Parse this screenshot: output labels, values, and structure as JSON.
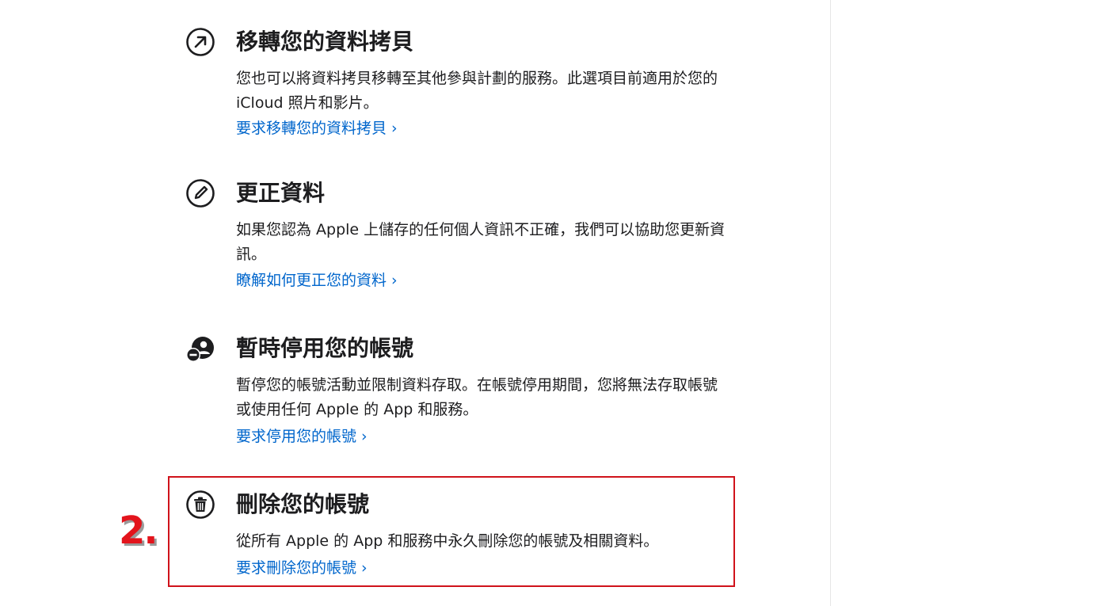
{
  "sections": [
    {
      "icon": "arrow-up-right-circle-icon",
      "title": "移轉您的資料拷貝",
      "desc": [
        "您也可以將資料拷貝移轉至其他參與計劃的服務。此選項目前適用於您的",
        "iCloud 照片和影片。"
      ],
      "link": "要求移轉您的資料拷貝 ›"
    },
    {
      "icon": "pencil-circle-icon",
      "title": "更正資料",
      "desc": [
        "如果您認為 Apple 上儲存的任何個人資訊不正確，我們可以協助您更新資",
        "訊。"
      ],
      "link": "瞭解如何更正您的資料 ›"
    },
    {
      "icon": "person-minus-icon",
      "title": "暫時停用您的帳號",
      "desc": [
        "暫停您的帳號活動並限制資料存取。在帳號停用期間，您將無法存取帳號",
        "或使用任何 Apple 的 App 和服務。"
      ],
      "link": "要求停用您的帳號 ›"
    },
    {
      "icon": "trash-circle-icon",
      "title": "刪除您的帳號",
      "desc": [
        "從所有 Apple 的 App 和服務中永久刪除您的帳號及相關資料。"
      ],
      "link": "要求刪除您的帳號 ›"
    }
  ],
  "annotation": {
    "step_label": "2.",
    "color": "#e3141c"
  },
  "colors": {
    "link": "#0066cc",
    "text": "#1d1d1f",
    "highlight": "#d0121b"
  }
}
